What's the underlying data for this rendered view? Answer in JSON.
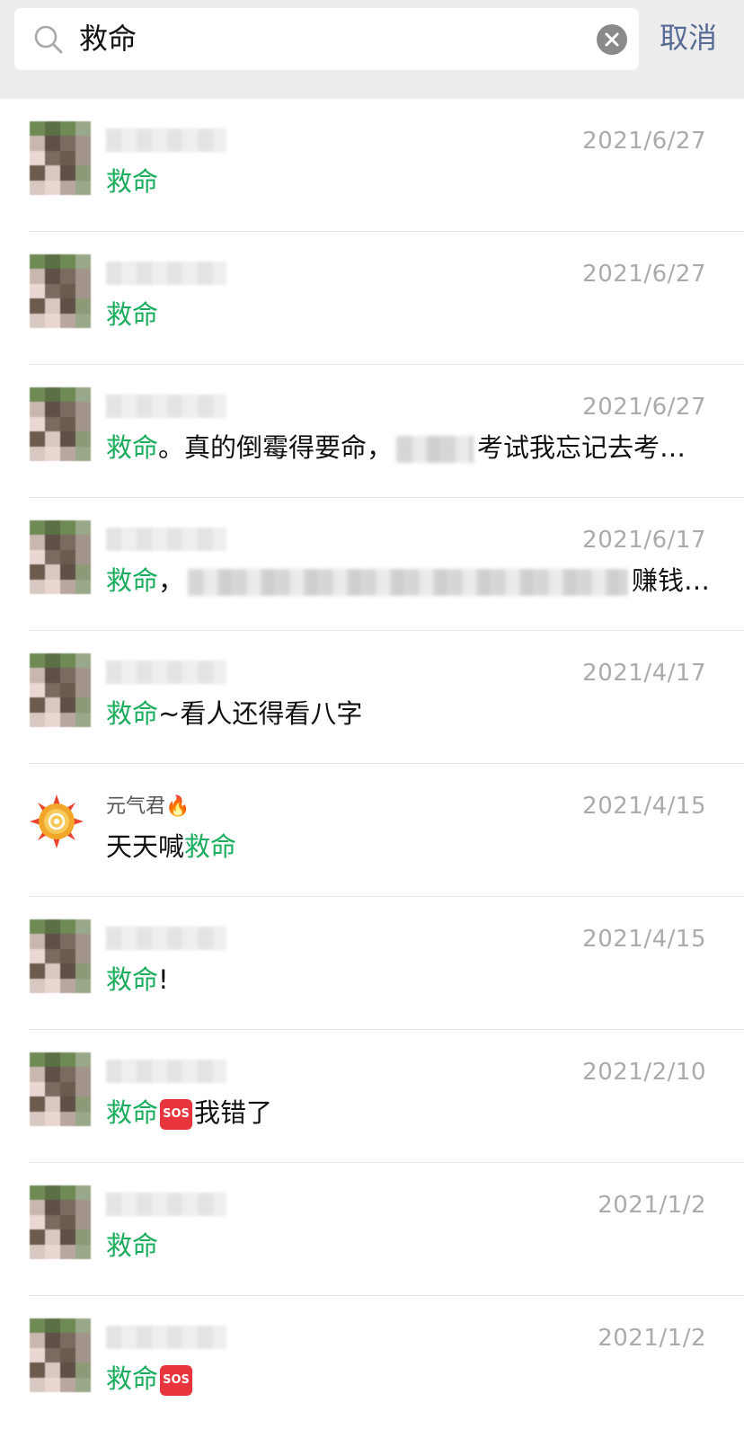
{
  "search": {
    "value": "救命",
    "cancel_label": "取消"
  },
  "colors": {
    "highlight": "#1aad5e",
    "cancel": "#576b95",
    "date": "#ababab",
    "sos_badge": "#e8343c"
  },
  "results": [
    {
      "date": "2021/6/27",
      "highlight": "救命",
      "after": ""
    },
    {
      "date": "2021/6/27",
      "highlight": "救命",
      "after": ""
    },
    {
      "date": "2021/6/27",
      "highlight": "救命",
      "mid": "。真的倒霉得要命，",
      "after": "考试我忘记去考…"
    },
    {
      "date": "2021/6/17",
      "highlight": "救命",
      "mid": "，",
      "after": "赚钱…"
    },
    {
      "date": "2021/4/17",
      "highlight": "救命",
      "after": "~看人还得看八字"
    },
    {
      "date": "2021/4/15",
      "name": "元气君🔥",
      "before": "天天喊",
      "highlight": "救命"
    },
    {
      "date": "2021/4/15",
      "highlight": "救命",
      "after": "!"
    },
    {
      "date": "2021/2/10",
      "highlight": "救命",
      "badge": "SOS",
      "after": "我错了"
    },
    {
      "date": "2021/1/2",
      "highlight": "救命",
      "after": ""
    },
    {
      "date": "2021/1/2",
      "highlight": "救命",
      "badge": "SOS",
      "after": ""
    }
  ]
}
